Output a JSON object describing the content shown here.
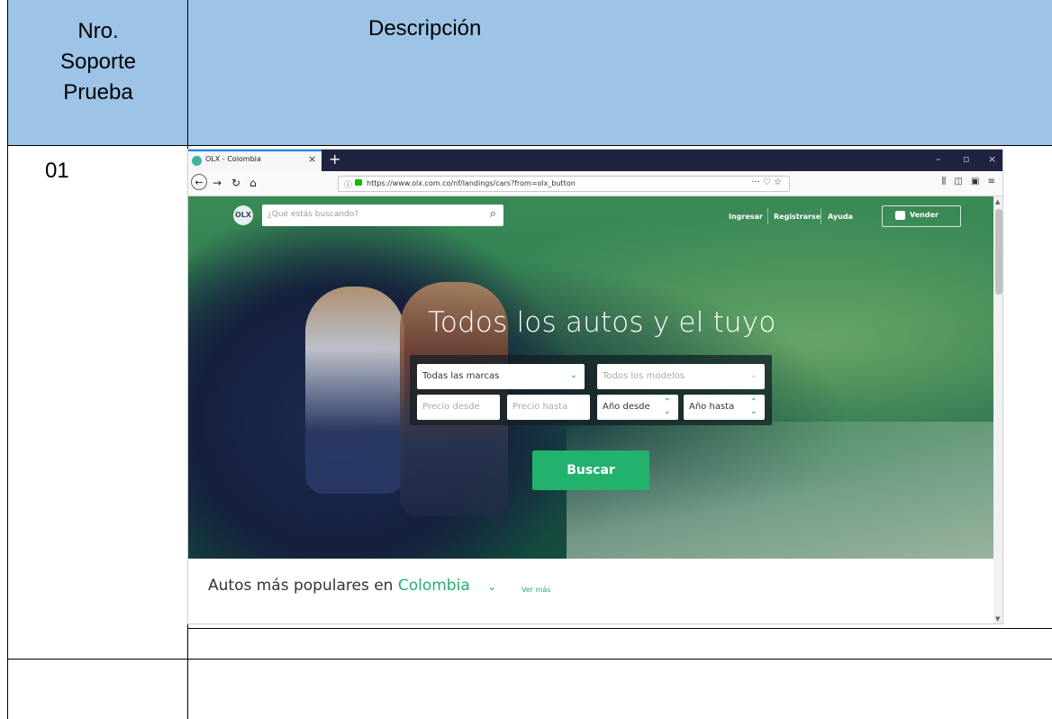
{
  "table": {
    "header_col1": [
      "Nro.",
      "Soporte",
      "Prueba"
    ],
    "header_col2": "Descripción",
    "row1_number": "01"
  },
  "browser": {
    "tab_title": "OLX - Colombia",
    "tab_close": "×",
    "new_tab": "+",
    "url": "https://www.olx.com.co/nf/landings/cars?from=olx_button",
    "url_actions": "··· ♡ ☆",
    "window_controls": [
      "–",
      "▫",
      "×"
    ],
    "toolbar_icons": "⫼ ◫ ▣ ≡"
  },
  "olx": {
    "logo": "OLX",
    "search_placeholder": "¿Qué estás buscando?",
    "nav": [
      "Ingresar",
      "Registrarse",
      "Ayuda"
    ],
    "sell_label": "Vender",
    "headline": "Todos los autos y el tuyo",
    "brand_select": "Todas las marcas",
    "model_select": "Todos los modelos",
    "price_from": "Precio desde",
    "price_to": "Precio hasta",
    "year_from": "Año desde",
    "year_to": "Año hasta",
    "search_button": "Buscar",
    "popular_prefix": "Autos más populares en ",
    "popular_country": "Colombia",
    "see_more": "Ver más"
  },
  "colors": {
    "table_header_bg": "#9dc3e6",
    "olx_green": "#23b26d",
    "browser_titlebar": "#202340"
  }
}
